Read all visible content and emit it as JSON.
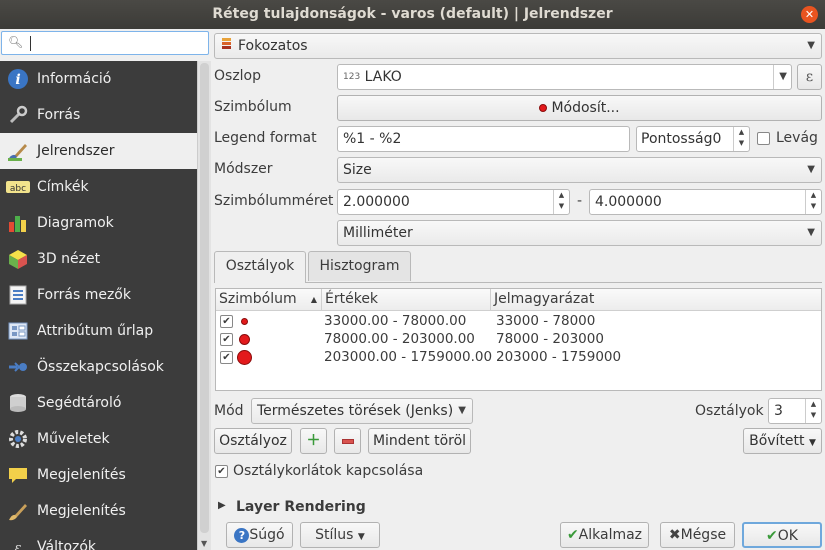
{
  "window": {
    "title": "Réteg tulajdonságok - varos (default) | Jelrendszer",
    "close_icon": "close-icon"
  },
  "sidebar": {
    "search": {
      "value": "",
      "icon": "search-icon"
    },
    "items": [
      {
        "label": "Információ",
        "icon": "info-icon"
      },
      {
        "label": "Forrás",
        "icon": "wrench-icon"
      },
      {
        "label": "Jelrendszer",
        "icon": "paintbrush-icon"
      },
      {
        "label": "Címkék",
        "icon": "abc-label-icon"
      },
      {
        "label": "Diagramok",
        "icon": "diagram-icon"
      },
      {
        "label": "3D nézet",
        "icon": "cube-icon"
      },
      {
        "label": "Forrás mezők",
        "icon": "fields-icon"
      },
      {
        "label": "Attribútum űrlap",
        "icon": "form-icon"
      },
      {
        "label": "Összekapcsolások",
        "icon": "join-icon"
      },
      {
        "label": "Segédtároló",
        "icon": "database-icon"
      },
      {
        "label": "Műveletek",
        "icon": "gear-icon"
      },
      {
        "label": "Megjelenítés",
        "icon": "speech-bubble-icon"
      },
      {
        "label": "Megjelenítés",
        "icon": "paintbrush-icon"
      },
      {
        "label": "Változók",
        "icon": "variables-icon"
      }
    ],
    "active_index": 2
  },
  "renderer": {
    "value": "Fokozatos"
  },
  "form": {
    "oszlop_label": "Oszlop",
    "oszlop_type": "123",
    "oszlop_value": "LAKO",
    "epsilon": "ε",
    "szimbolum_label": "Szimbólum",
    "modosit_label": "Módosít...",
    "legend_label": "Legend format",
    "legend_value": "%1 - %2",
    "pontossag_value": "Pontosság0",
    "levag_label": "Levág",
    "modszer_label": "Módszer",
    "modszer_value": "Size",
    "meret_label": "Szimbólumméret",
    "meret_min": "2.000000",
    "meret_dash": "-",
    "meret_max": "4.000000",
    "unit_value": "Milliméter"
  },
  "tabs": [
    "Osztályok",
    "Hisztogram"
  ],
  "table": {
    "headers": [
      "Szimbólum",
      "Értékek",
      "Jelmagyarázat"
    ],
    "rows": [
      {
        "values": "33000.00 - 78000.00",
        "legend": "33000 - 78000"
      },
      {
        "values": "78000.00 - 203000.00",
        "legend": "78000 - 203000"
      },
      {
        "values": "203000.00 - 1759000.00",
        "legend": "203000 - 1759000"
      }
    ]
  },
  "classify": {
    "mod_label": "Mód",
    "mod_value": "Természetes törések (Jenks)",
    "osztalyok_label": "Osztályok",
    "osztalyok_value": "3",
    "osztalyoz_button": "Osztályoz",
    "add_icon": "plus-icon",
    "remove_icon": "minus-icon",
    "clear_button": "Mindent töröl",
    "advanced_button": "Bővített",
    "link_label": "Osztálykorlátok kapcsolása"
  },
  "layer_rendering": {
    "label": "Layer Rendering"
  },
  "footer": {
    "help": "Súgó",
    "style": "Stílus",
    "apply": "Alkalmaz",
    "cancel": "Mégse",
    "ok": "OK"
  },
  "colors": {
    "symbol_red": "#e31a1c",
    "sidebar_bg": "#3c3c3c",
    "focus_blue": "#7eb4ea"
  }
}
